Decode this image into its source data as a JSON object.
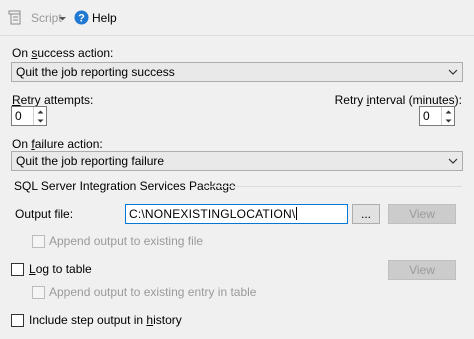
{
  "toolbar": {
    "script_label": "Script",
    "help_label": "Help"
  },
  "on_success": {
    "label_pre": "On ",
    "label_key": "s",
    "label_post": "uccess action:",
    "value": "Quit the job reporting success"
  },
  "retry_attempts": {
    "label_key": "R",
    "label_post": "etry attempts:",
    "value": "0"
  },
  "retry_interval": {
    "label_pre": "Retry ",
    "label_key": "i",
    "label_post": "nterval (minutes):",
    "value": "0"
  },
  "on_failure": {
    "label_pre": "On ",
    "label_key": "f",
    "label_post": "ailure action:",
    "value": "Quit the job reporting failure"
  },
  "ssis": {
    "group_title": "SQL Server Integration Services Package",
    "output_file_label": "Output file:",
    "output_file_value": "C:\\NONEXISTINGLOCATION\\",
    "browse_label": "...",
    "view_label": "View",
    "append_output_label": "Append output to existing file"
  },
  "log_to_table": {
    "label_key": "L",
    "label_post": "og to table",
    "view_label": "View",
    "append_entry_label": "Append output to existing entry in table"
  },
  "include_step": {
    "label_pre": "Include step output in ",
    "label_key": "h",
    "label_post": "istory"
  }
}
